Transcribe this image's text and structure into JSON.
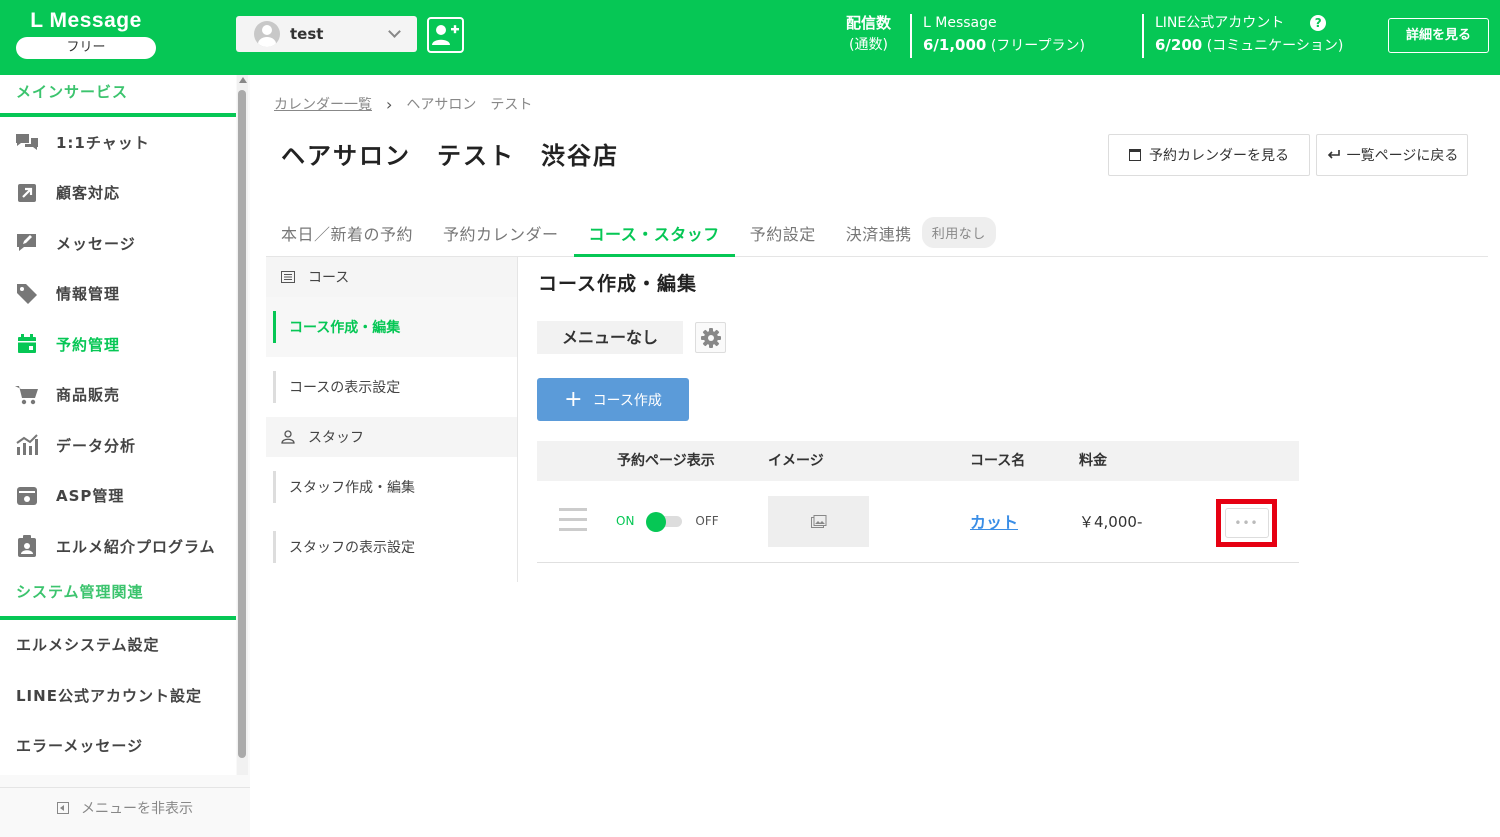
{
  "header": {
    "logo": "L Message",
    "plan": "フリー",
    "account_name": "test",
    "stats": {
      "sent_label": "配信数",
      "sent_sub": "(通数)",
      "lmessage_label": "L Message",
      "lmessage_value": "6/1,000",
      "lmessage_plan": "(フリープラン)",
      "line_label": "LINE公式アカウント",
      "line_value": "6/200",
      "line_plan": "(コミュニケーション)"
    },
    "help": "?",
    "detail_button": "詳細を見る"
  },
  "sidebar": {
    "main_section": "メインサービス",
    "items": [
      {
        "label": "1:1チャット",
        "icon": "chat-icon"
      },
      {
        "label": "顧客対応",
        "icon": "arrow-box-icon"
      },
      {
        "label": "メッセージ",
        "icon": "message-edit-icon"
      },
      {
        "label": "情報管理",
        "icon": "tag-icon"
      },
      {
        "label": "予約管理",
        "icon": "calendar-icon"
      },
      {
        "label": "商品販売",
        "icon": "cart-icon"
      },
      {
        "label": "データ分析",
        "icon": "chart-icon"
      },
      {
        "label": "ASP管理",
        "icon": "asp-icon"
      },
      {
        "label": "エルメ紹介プログラム",
        "icon": "clipboard-user-icon"
      }
    ],
    "system_section": "システム管理関連",
    "system_items": [
      "エルメシステム設定",
      "LINE公式アカウント設定",
      "エラーメッセージ"
    ],
    "hide_menu": "メニューを非表示",
    "colors": {
      "accent": "#06c755"
    }
  },
  "breadcrumb": {
    "parent": "カレンダー一覧",
    "sep": "›",
    "current": "ヘアサロン　テスト"
  },
  "page": {
    "title": "ヘアサロン　テスト　渋谷店",
    "view_calendar_button": "予約カレンダーを見る",
    "back_button": "一覧ページに戻る"
  },
  "tabs": [
    {
      "label": "本日／新着の予約"
    },
    {
      "label": "予約カレンダー"
    },
    {
      "label": "コース・スタッフ"
    },
    {
      "label": "予約設定"
    },
    {
      "label": "決済連携"
    }
  ],
  "tab_badge": "利用なし",
  "subnav": {
    "course_head": "コース",
    "course_items": [
      "コース作成・編集",
      "コースの表示設定"
    ],
    "staff_head": "スタッフ",
    "staff_items": [
      "スタッフ作成・編集",
      "スタッフの表示設定"
    ]
  },
  "content": {
    "title": "コース作成・編集",
    "menu_label": "メニューなし",
    "create_button": "コース作成",
    "table": {
      "headers": [
        "予約ページ表示",
        "イメージ",
        "コース名",
        "料金"
      ],
      "rows": [
        {
          "on": "ON",
          "off": "OFF",
          "course": "カット",
          "price": "￥4,000-",
          "more": "•••"
        }
      ]
    }
  }
}
